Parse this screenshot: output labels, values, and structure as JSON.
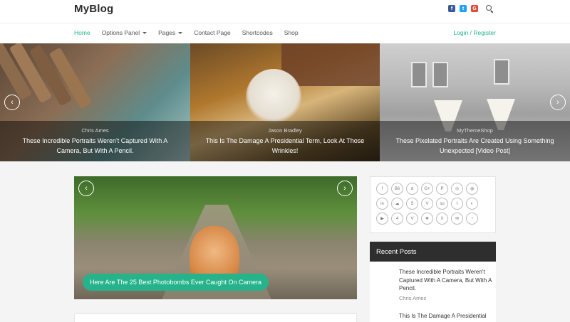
{
  "site": {
    "title": "MyBlog"
  },
  "top_icons": [
    {
      "name": "facebook-icon",
      "glyph": "f",
      "color": "#3b5998"
    },
    {
      "name": "twitter-icon",
      "glyph": "t",
      "color": "#1da1f2"
    },
    {
      "name": "google-plus-icon",
      "glyph": "G",
      "color": "#dd4b39"
    }
  ],
  "nav": {
    "items": [
      "Home",
      "Options Panel",
      "Pages",
      "Contact Page",
      "Shortcodes",
      "Shop"
    ],
    "login": "Login / Register"
  },
  "hero_slides": [
    {
      "author": "Chris Ames",
      "title": "These Incredible Portraits Weren't Captured With A Camera, But With A Pencil."
    },
    {
      "author": "Jason Bradley",
      "title": "This Is The Damage A Presidential Term, Look At Those Wrinkles!"
    },
    {
      "author": "MyThemeShop",
      "title": "These Pixelated Portraits Are Created Using Something Unexpected [Video Post]"
    }
  ],
  "featured": {
    "title": "Here Are The 25 Best Photobombs Ever Caught On Camera"
  },
  "social_icons": [
    [
      "facebook-icon",
      "behance-icon",
      "digg-icon",
      "google-plus-icon",
      "pinterest-icon",
      "instagram-icon",
      "dribbble-icon"
    ],
    [
      "linkedin-icon",
      "soundcloud-icon",
      "skype-icon",
      "vimeo-icon",
      "stumbleupon-icon",
      "tumblr-icon",
      "github-icon"
    ],
    [
      "youtube-icon",
      "foursquare-icon",
      "vine-icon",
      "dropbox-icon",
      "xing-icon",
      "email-icon",
      "rss-icon"
    ]
  ],
  "social_glyphs": [
    [
      "f",
      "Bē",
      "d",
      "G+",
      "P",
      "◎",
      "◍"
    ],
    [
      "in",
      "☁",
      "S",
      "V",
      "su",
      "t",
      "◐"
    ],
    [
      "▶",
      "4",
      "V",
      "❖",
      "X",
      "✉",
      "◔"
    ]
  ],
  "recent": {
    "heading": "Recent Posts",
    "posts": [
      {
        "title": "These Incredible Portraits Weren't Captured With A Camera, But With A Pencil.",
        "author": "Chris Ames"
      },
      {
        "title": "This Is The Damage A Presidential",
        "author": ""
      }
    ]
  }
}
